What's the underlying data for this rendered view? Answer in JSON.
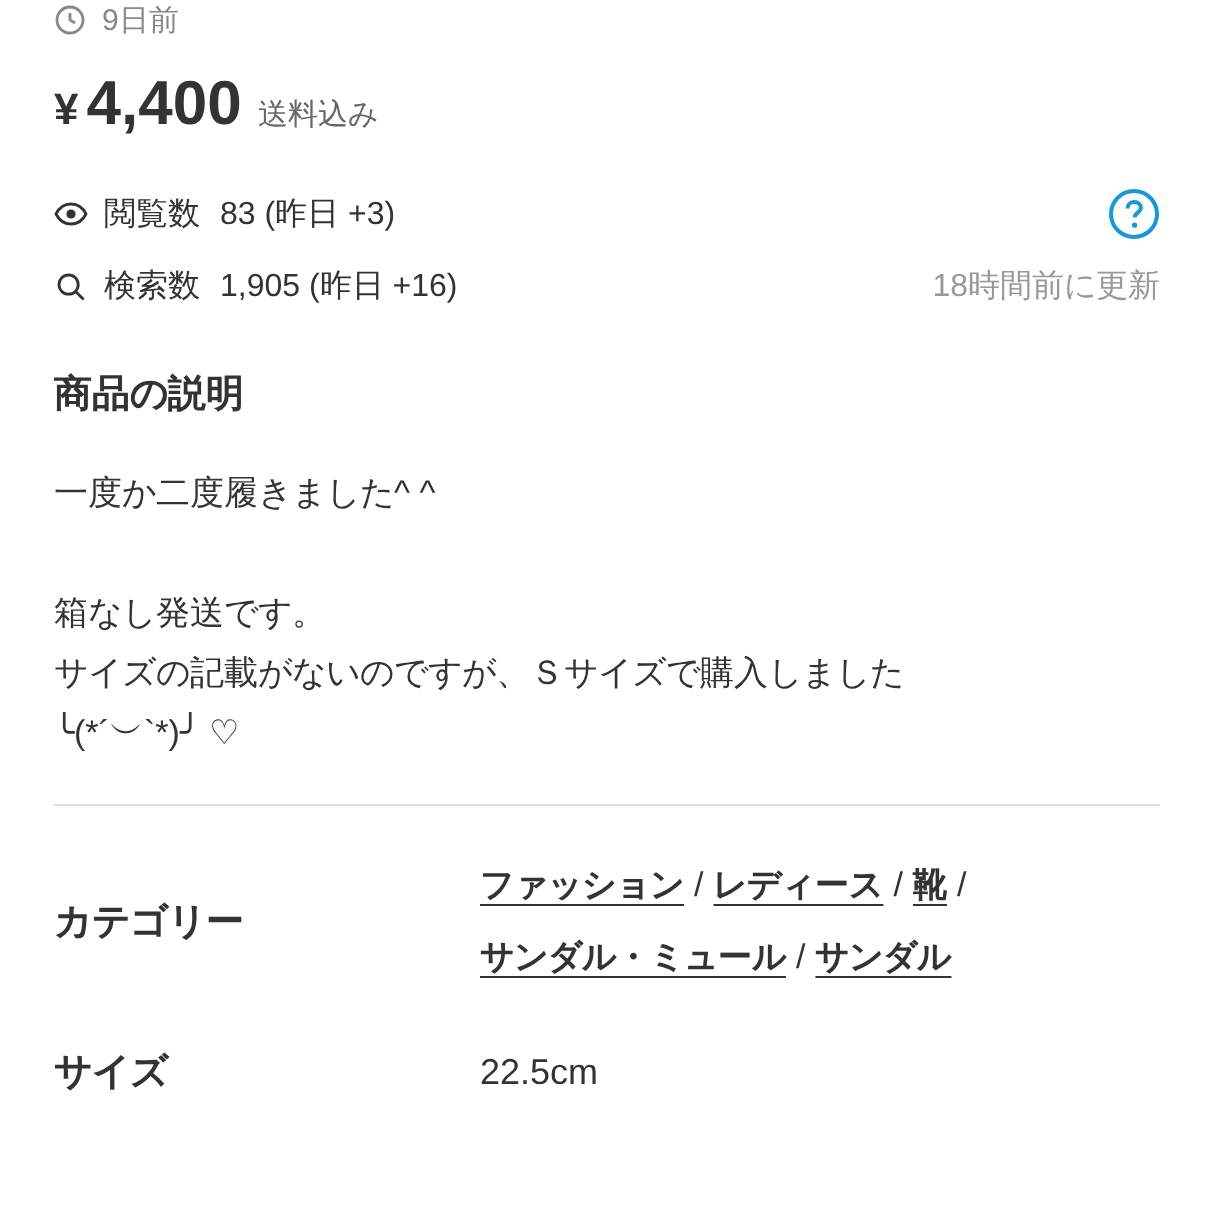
{
  "posted": "9日前",
  "price": {
    "currency": "¥",
    "amount": "4,400",
    "note": "送料込み"
  },
  "stats": [
    {
      "kind": "views",
      "label": "閲覧数",
      "value": "83 (昨日 +3)"
    },
    {
      "kind": "searches",
      "label": "検索数",
      "value": "1,905 (昨日 +16)"
    }
  ],
  "updated": "18時間前に更新",
  "description": {
    "heading": "商品の説明",
    "paragraphs": [
      [
        "一度か二度履きました^ ^"
      ],
      [
        "箱なし発送です。",
        "サイズの記載がないのですが、Ｓサイズで購入しました",
        "╰(*´︶`*)╯ ♡"
      ]
    ]
  },
  "details": [
    {
      "kind": "links",
      "label": "カテゴリー",
      "separator": "/",
      "links": [
        "ファッション",
        "レディース",
        "靴",
        "サンダル・ミュール",
        "サンダル"
      ]
    },
    {
      "kind": "text",
      "label": "サイズ",
      "value": "22.5cm"
    }
  ]
}
